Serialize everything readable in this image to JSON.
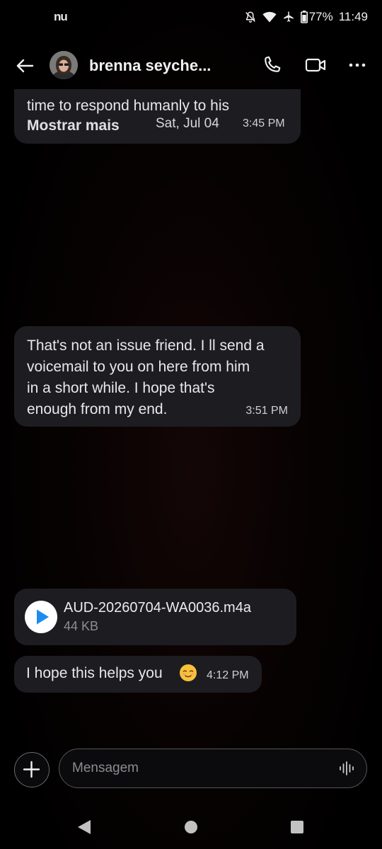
{
  "status_bar": {
    "carrier": "nu",
    "battery": "77%",
    "time": "11:49"
  },
  "header": {
    "contact_name": "brenna seyche...",
    "icons": {
      "back": "arrow-left-icon",
      "call": "phone-icon",
      "video": "video-camera-icon",
      "more": "more-horizontal-icon"
    }
  },
  "messages": [
    {
      "text": "time to respond humanly to his",
      "show_more": "Mostrar mais",
      "date": "Sat, Jul 04",
      "time": "3:45 PM"
    },
    {
      "lines": [
        "That's not an issue friend. I ll send a",
        "voicemail to you on here from him",
        "in a short while. I hope that's",
        "enough from my end."
      ],
      "time": "3:51 PM"
    },
    {
      "file_name": "AUD-20260704-WA0036.m4a",
      "file_size": "44 KB"
    },
    {
      "text": "I hope this helps you",
      "emoji": "smiling-face-icon",
      "time": "4:12 PM"
    }
  ],
  "composer": {
    "placeholder": "Mensagem",
    "add_icon": "plus-icon",
    "voice_icon": "voice-waveform-icon"
  },
  "colors": {
    "bubble": "#1d1d21",
    "accent": "#1d8cf0",
    "background": "#000000"
  }
}
